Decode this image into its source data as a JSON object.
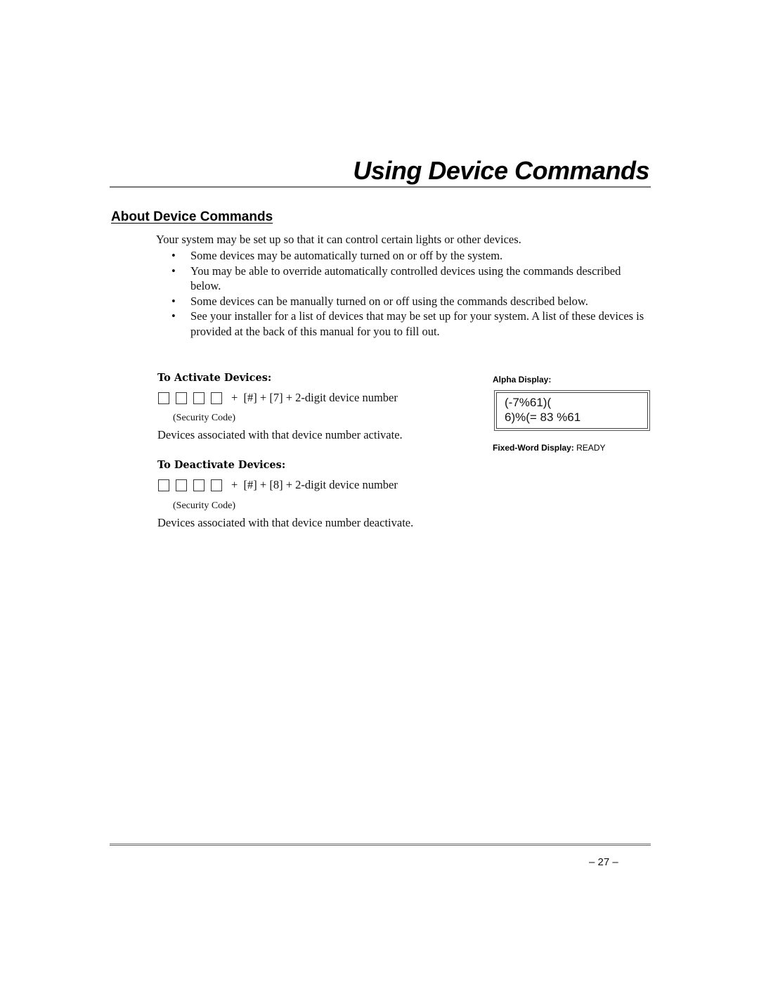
{
  "header": {
    "title": "Using Device Commands"
  },
  "section": {
    "heading": "About Device Commands",
    "intro": "Your system may be set up so that it can control certain lights or other devices.",
    "bullet_glyph": "•",
    "bullets": [
      "Some devices may be automatically turned on or off by the system.",
      "You may be able to override automatically controlled devices using the commands described below.",
      "Some devices can be manually turned on or off using the commands described below.",
      "See your installer for a list of devices that may be set up for your system. A list of these devices is provided at the back of this manual for you to fill out."
    ]
  },
  "activate": {
    "heading": "To Activate Devices:",
    "command": "+  [#] + [7] + 2-digit device number",
    "code_label": "(Security Code)",
    "result": "Devices associated with that device number activate."
  },
  "deactivate": {
    "heading": "To Deactivate Devices:",
    "command": "+  [#] + [8] + 2-digit device number",
    "code_label": "(Security Code)",
    "result": "Devices associated with that device number deactivate."
  },
  "display": {
    "alpha_label": "Alpha Display:",
    "alpha_line1": "(-7%61)(",
    "alpha_line2": "6)%(= 83 %61",
    "fixed_word_label": "Fixed-Word Display:",
    "fixed_word_value": "READY"
  },
  "footer": {
    "page_number": "– 27 –"
  }
}
